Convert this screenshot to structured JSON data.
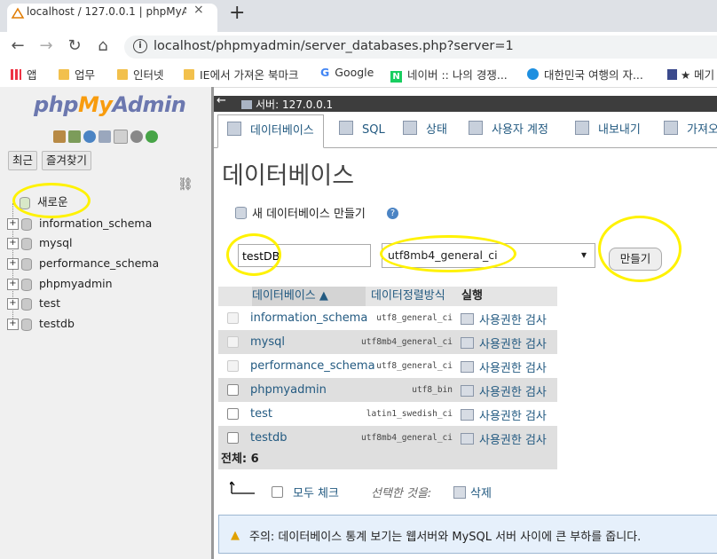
{
  "browser": {
    "tab_title": "localhost / 127.0.0.1 | phpMyAd",
    "tab_close": "×",
    "new_tab": "+",
    "url": "localhost/phpmyadmin/server_databases.php?server=1",
    "nav": {
      "back": "←",
      "forward": "→",
      "reload": "↻",
      "home": "⌂"
    },
    "bookmarks": [
      {
        "label": "앱",
        "icon": "apps-grid-icon"
      },
      {
        "label": "업무",
        "icon": "folder-icon"
      },
      {
        "label": "인터넷",
        "icon": "folder-icon"
      },
      {
        "label": "IE에서 가져온 북마크",
        "icon": "folder-icon"
      },
      {
        "label": "Google",
        "icon": "google-icon"
      },
      {
        "label": "네이버 :: 나의 경쟁...",
        "icon": "naver-icon"
      },
      {
        "label": "대한민국 여행의 자...",
        "icon": "travel-icon"
      },
      {
        "label": "★ 메기",
        "icon": "bookmark-icon"
      }
    ]
  },
  "sidebar": {
    "logo": {
      "php": "php",
      "my": "My",
      "admin": "Admin"
    },
    "recent_button": "최근",
    "favorites_button": "즐겨찾기",
    "tree": [
      {
        "label": "새로운",
        "type": "new"
      },
      {
        "label": "information_schema"
      },
      {
        "label": "mysql"
      },
      {
        "label": "performance_schema"
      },
      {
        "label": "phpmyadmin"
      },
      {
        "label": "test"
      },
      {
        "label": "testdb"
      }
    ]
  },
  "serverbar": {
    "label": "서버: 127.0.0.1",
    "back": "←"
  },
  "tabs": [
    {
      "label": "데이터베이스",
      "active": true
    },
    {
      "label": "SQL"
    },
    {
      "label": "상태"
    },
    {
      "label": "사용자 계정"
    },
    {
      "label": "내보내기"
    },
    {
      "label": "가져오"
    }
  ],
  "main": {
    "title": "데이터베이스",
    "create_heading": "새 데이터베이스 만들기",
    "db_name_value": "testDB",
    "collation_value": "utf8mb4_general_ci",
    "create_button": "만들기",
    "table": {
      "headers": {
        "database": "데이터베이스 ▲",
        "collation": "데이터정렬방식",
        "action": "실행"
      },
      "rows": [
        {
          "name": "information_schema",
          "collation": "utf8_general_ci",
          "action": "사용권한 검사",
          "checkbox_enabled": false
        },
        {
          "name": "mysql",
          "collation": "utf8mb4_general_ci",
          "action": "사용권한 검사",
          "checkbox_enabled": false
        },
        {
          "name": "performance_schema",
          "collation": "utf8_general_ci",
          "action": "사용권한 검사",
          "checkbox_enabled": false
        },
        {
          "name": "phpmyadmin",
          "collation": "utf8_bin",
          "action": "사용권한 검사",
          "checkbox_enabled": true
        },
        {
          "name": "test",
          "collation": "latin1_swedish_ci",
          "action": "사용권한 검사",
          "checkbox_enabled": true
        },
        {
          "name": "testdb",
          "collation": "utf8mb4_general_ci",
          "action": "사용권한 검사",
          "checkbox_enabled": true
        }
      ],
      "total": "전체: 6"
    },
    "check_all": "모두 체크",
    "with_selected": "선택한 것을:",
    "delete": "삭제",
    "notice": "주의: 데이터베이스 통계 보기는 웹서버와 MySQL 서버 사이에 큰 부하를 줍니다."
  },
  "colors": {
    "highlight": "#fff200",
    "link": "#235a81",
    "accent_orange": "#f89c0e"
  }
}
